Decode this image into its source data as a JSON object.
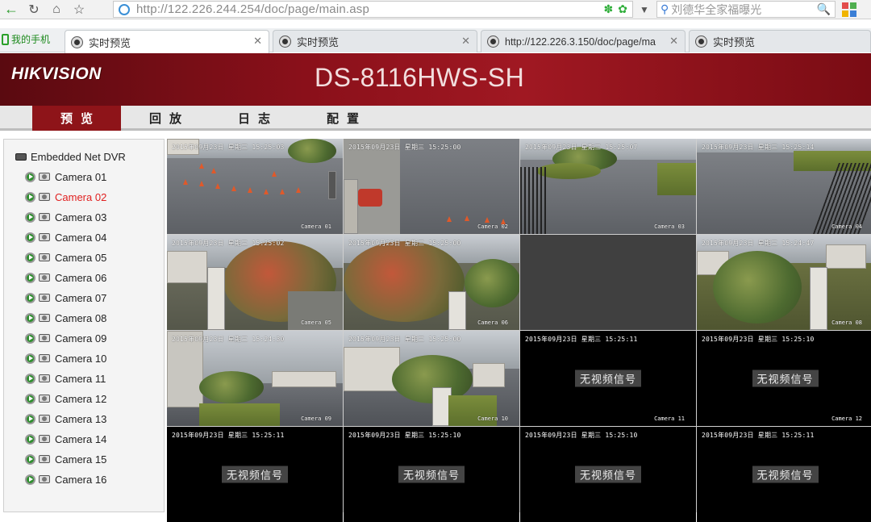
{
  "browser": {
    "url": "http://122.226.244.254/doc/page/main.asp",
    "search_placeholder": "刘德华全家福曝光",
    "mobile_label": "我的手机",
    "tabs": [
      {
        "title": "实时预览",
        "active": true
      },
      {
        "title": "实时预览",
        "active": false
      },
      {
        "title": "http://122.226.3.150/doc/page/ma",
        "active": false
      },
      {
        "title": "实时预览",
        "active": false
      }
    ]
  },
  "header": {
    "logo": "HIKVISION",
    "model": "DS-8116HWS-SH"
  },
  "nav": {
    "items": [
      "预览",
      "回放",
      "日志",
      "配置"
    ],
    "active_index": 0
  },
  "sidebar": {
    "root": "Embedded Net DVR",
    "cameras": [
      "Camera 01",
      "Camera 02",
      "Camera 03",
      "Camera 04",
      "Camera 05",
      "Camera 06",
      "Camera 07",
      "Camera 08",
      "Camera 09",
      "Camera 10",
      "Camera 11",
      "Camera 12",
      "Camera 13",
      "Camera 14",
      "Camera 15",
      "Camera 16"
    ],
    "selected": "Camera 02"
  },
  "grid": {
    "cells": [
      {
        "osd": "2015年09月23日 星期三 15:25:03",
        "label": "Camera 01",
        "signal": true
      },
      {
        "osd": "2015年09月23日 星期三 15:25:00",
        "label": "Camera 02",
        "signal": true
      },
      {
        "osd": "2015年09月23日 星期三 15:25:07",
        "label": "Camera 03",
        "signal": true
      },
      {
        "osd": "2015年09月23日 星期三 15:25:14",
        "label": "Camera 04",
        "signal": true
      },
      {
        "osd": "2015年09月23日 星期三 15:25:02",
        "label": "Camera 05",
        "signal": true
      },
      {
        "osd": "2015年09月23日 星期三 15:25:00",
        "label": "Camera 06",
        "signal": true
      },
      {
        "osd": "",
        "label": "",
        "signal": false,
        "empty": true
      },
      {
        "osd": "2015年09月23日 星期三 15:24:47",
        "label": "Camera 08",
        "signal": true
      },
      {
        "osd": "2015年09月23日 星期三 15:24:30",
        "label": "Camera 09",
        "signal": true
      },
      {
        "osd": "2015年09月23日 星期三 15:25:00",
        "label": "Camera 10",
        "signal": true
      },
      {
        "osd": "2015年09月23日 星期三 15:25:11",
        "label": "Camera 11",
        "signal": false
      },
      {
        "osd": "2015年09月23日 星期三 15:25:10",
        "label": "Camera 12",
        "signal": false
      },
      {
        "osd": "2015年09月23日 星期三 15:25:11",
        "label": "",
        "signal": false
      },
      {
        "osd": "2015年09月23日 星期三 15:25:10",
        "label": "",
        "signal": false
      },
      {
        "osd": "2015年09月23日 星期三 15:25:10",
        "label": "",
        "signal": false
      },
      {
        "osd": "2015年09月23日 星期三 15:25:11",
        "label": "",
        "signal": false
      }
    ],
    "no_signal_text": "无视频信号",
    "selected_index": 1
  },
  "colors": {
    "header_red": "#8a101a",
    "nav_active": "#8e1419",
    "selected_camera_text": "#e02020",
    "selected_cell_border": "#e1c22a"
  }
}
